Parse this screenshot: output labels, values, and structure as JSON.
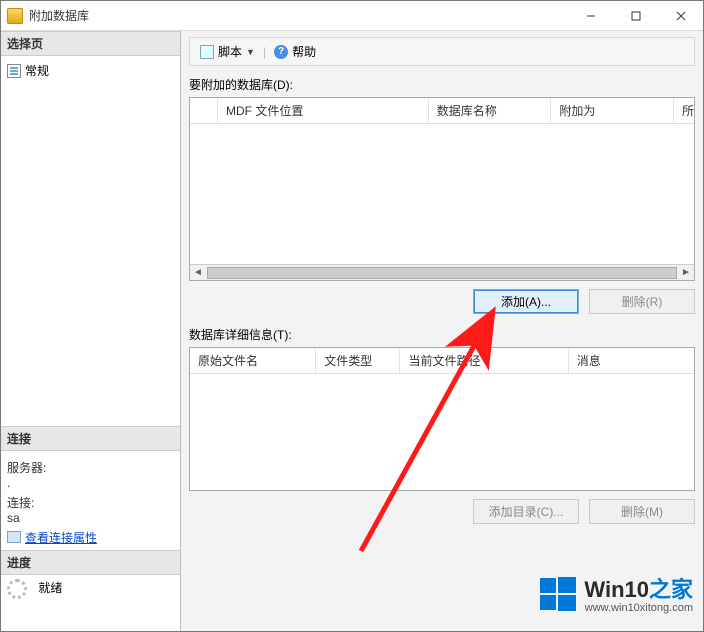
{
  "title": "附加数据库",
  "left": {
    "select_page_header": "选择页",
    "general": "常规",
    "connection_header": "连接",
    "server_label": "服务器:",
    "server_value": ".",
    "connection_label": "连接:",
    "connection_value": "sa",
    "view_props": "查看连接属性",
    "progress_header": "进度",
    "progress_status": "就绪"
  },
  "toolbar": {
    "script": "脚本",
    "help": "帮助"
  },
  "main": {
    "attach_label": "要附加的数据库(D):",
    "db_columns": [
      "MDF 文件位置",
      "数据库名称",
      "附加为",
      "所"
    ],
    "add_button": "添加(A)...",
    "remove_button": "删除(R)",
    "detail_label": "数据库详细信息(T):",
    "detail_columns": [
      "原始文件名",
      "文件类型",
      "当前文件路径",
      "消息"
    ],
    "add_dir_button": "添加目录(C)...",
    "remove2_button": "删除(M)"
  },
  "watermark": {
    "brand_a": "Win10",
    "brand_b": "之家",
    "url": "www.win10xitong.com"
  }
}
